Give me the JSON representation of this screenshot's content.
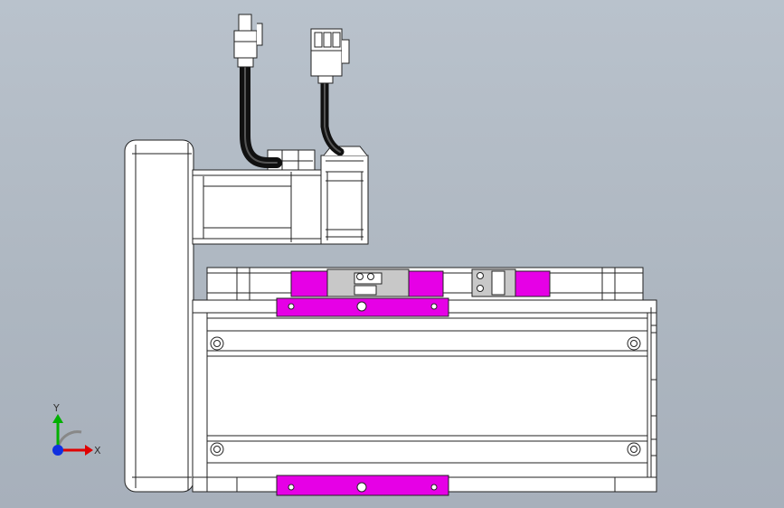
{
  "viewport": {
    "background_top": "#b9c2cc",
    "background_bottom": "#a7b0bb"
  },
  "colors": {
    "part_fill": "#ffffff",
    "edge": "#222222",
    "slider": "#e600e6",
    "bracket": "#c8c8c8",
    "cable": "#1a1a1a",
    "axis_x": "#e00000",
    "axis_y": "#00b000",
    "axis_z": "#1030e0"
  },
  "triad": {
    "x_label": "X",
    "y_label": "Y",
    "icon": "coordinate-triad-icon"
  }
}
